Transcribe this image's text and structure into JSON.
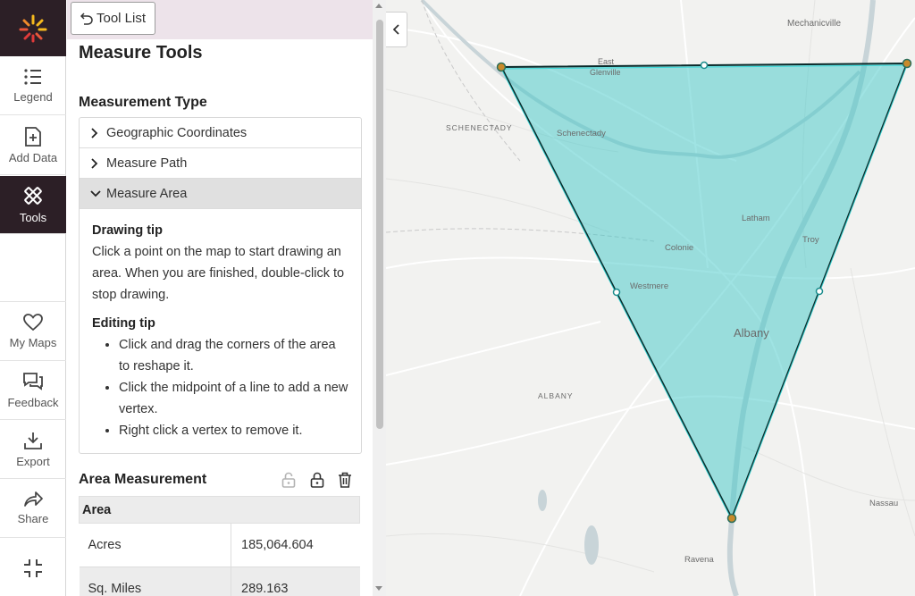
{
  "rail": {
    "legend": "Legend",
    "add_data": "Add Data",
    "tools": "Tools",
    "my_maps": "My Maps",
    "feedback": "Feedback",
    "export": "Export",
    "share": "Share"
  },
  "panel": {
    "tool_list_button": "Tool List",
    "title": "Measure Tools",
    "measurement_type_heading": "Measurement Type",
    "options": [
      {
        "label": "Geographic Coordinates",
        "expanded": false
      },
      {
        "label": "Measure Path",
        "expanded": false
      },
      {
        "label": "Measure Area",
        "expanded": true
      }
    ],
    "drawing_tip_heading": "Drawing tip",
    "drawing_tip_text": "Click a point on the map to start drawing an area. When you are finished, double-click to stop drawing.",
    "editing_tip_heading": "Editing tip",
    "editing_tips": [
      "Click and drag the corners of the area to reshape it.",
      "Click the midpoint of a line to add a new vertex.",
      "Right click a vertex to remove it."
    ],
    "area_measurement_heading": "Area Measurement",
    "area_table": {
      "header": "Area",
      "rows": [
        {
          "unit": "Acres",
          "value": "185,064.604"
        },
        {
          "unit": "Sq. Miles",
          "value": "289.163"
        }
      ]
    }
  },
  "map": {
    "labels": {
      "mechanicville": "Mechanicville",
      "east": "East",
      "glenville": "Glenville",
      "schenectady_county": "SCHENECTADY",
      "schenectady": "Schenectady",
      "latham": "Latham",
      "troy": "Troy",
      "colonie": "Colonie",
      "westmere": "Westmere",
      "albany": "Albany",
      "albany_county": "ALBANY",
      "nassau": "Nassau",
      "ravena": "Ravena"
    }
  },
  "colors": {
    "rail_dark": "#2c1f26",
    "panel_top": "#ede3ea",
    "polygon_fill": "#40c8c8",
    "polygon_stroke": "#0a2a2a",
    "vertex": "#c98a2a"
  }
}
